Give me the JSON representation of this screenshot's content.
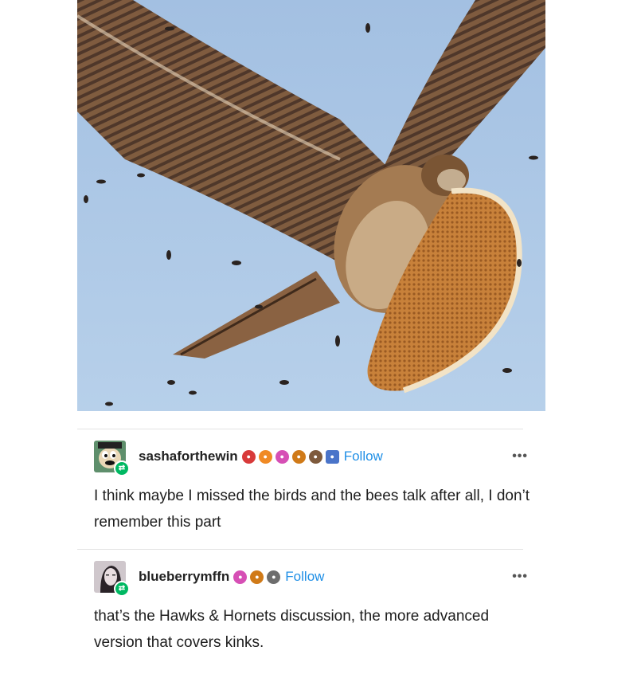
{
  "post_image": {
    "colors": {
      "sky": "#a9c6e6",
      "wing": "#7a5534",
      "honeycomb": "#c8813a"
    }
  },
  "comments": [
    {
      "username": "sashaforthewin",
      "follow_label": "Follow",
      "more_label": "•••",
      "badges": [
        "#d83a3a",
        "#f08a24",
        "#d64fb5",
        "#d07a18",
        "#7e5a3c",
        "#4a74c9"
      ],
      "text": "I think maybe I missed the birds and the bees talk after all, I don’t remember this part"
    },
    {
      "username": "blueberrymffn",
      "follow_label": "Follow",
      "more_label": "•••",
      "badges": [
        "#d64fb5",
        "#d07a18",
        "#6d6d6d"
      ],
      "text": "that’s the Hawks & Hornets discussion, the more advanced version that covers kinks."
    }
  ]
}
